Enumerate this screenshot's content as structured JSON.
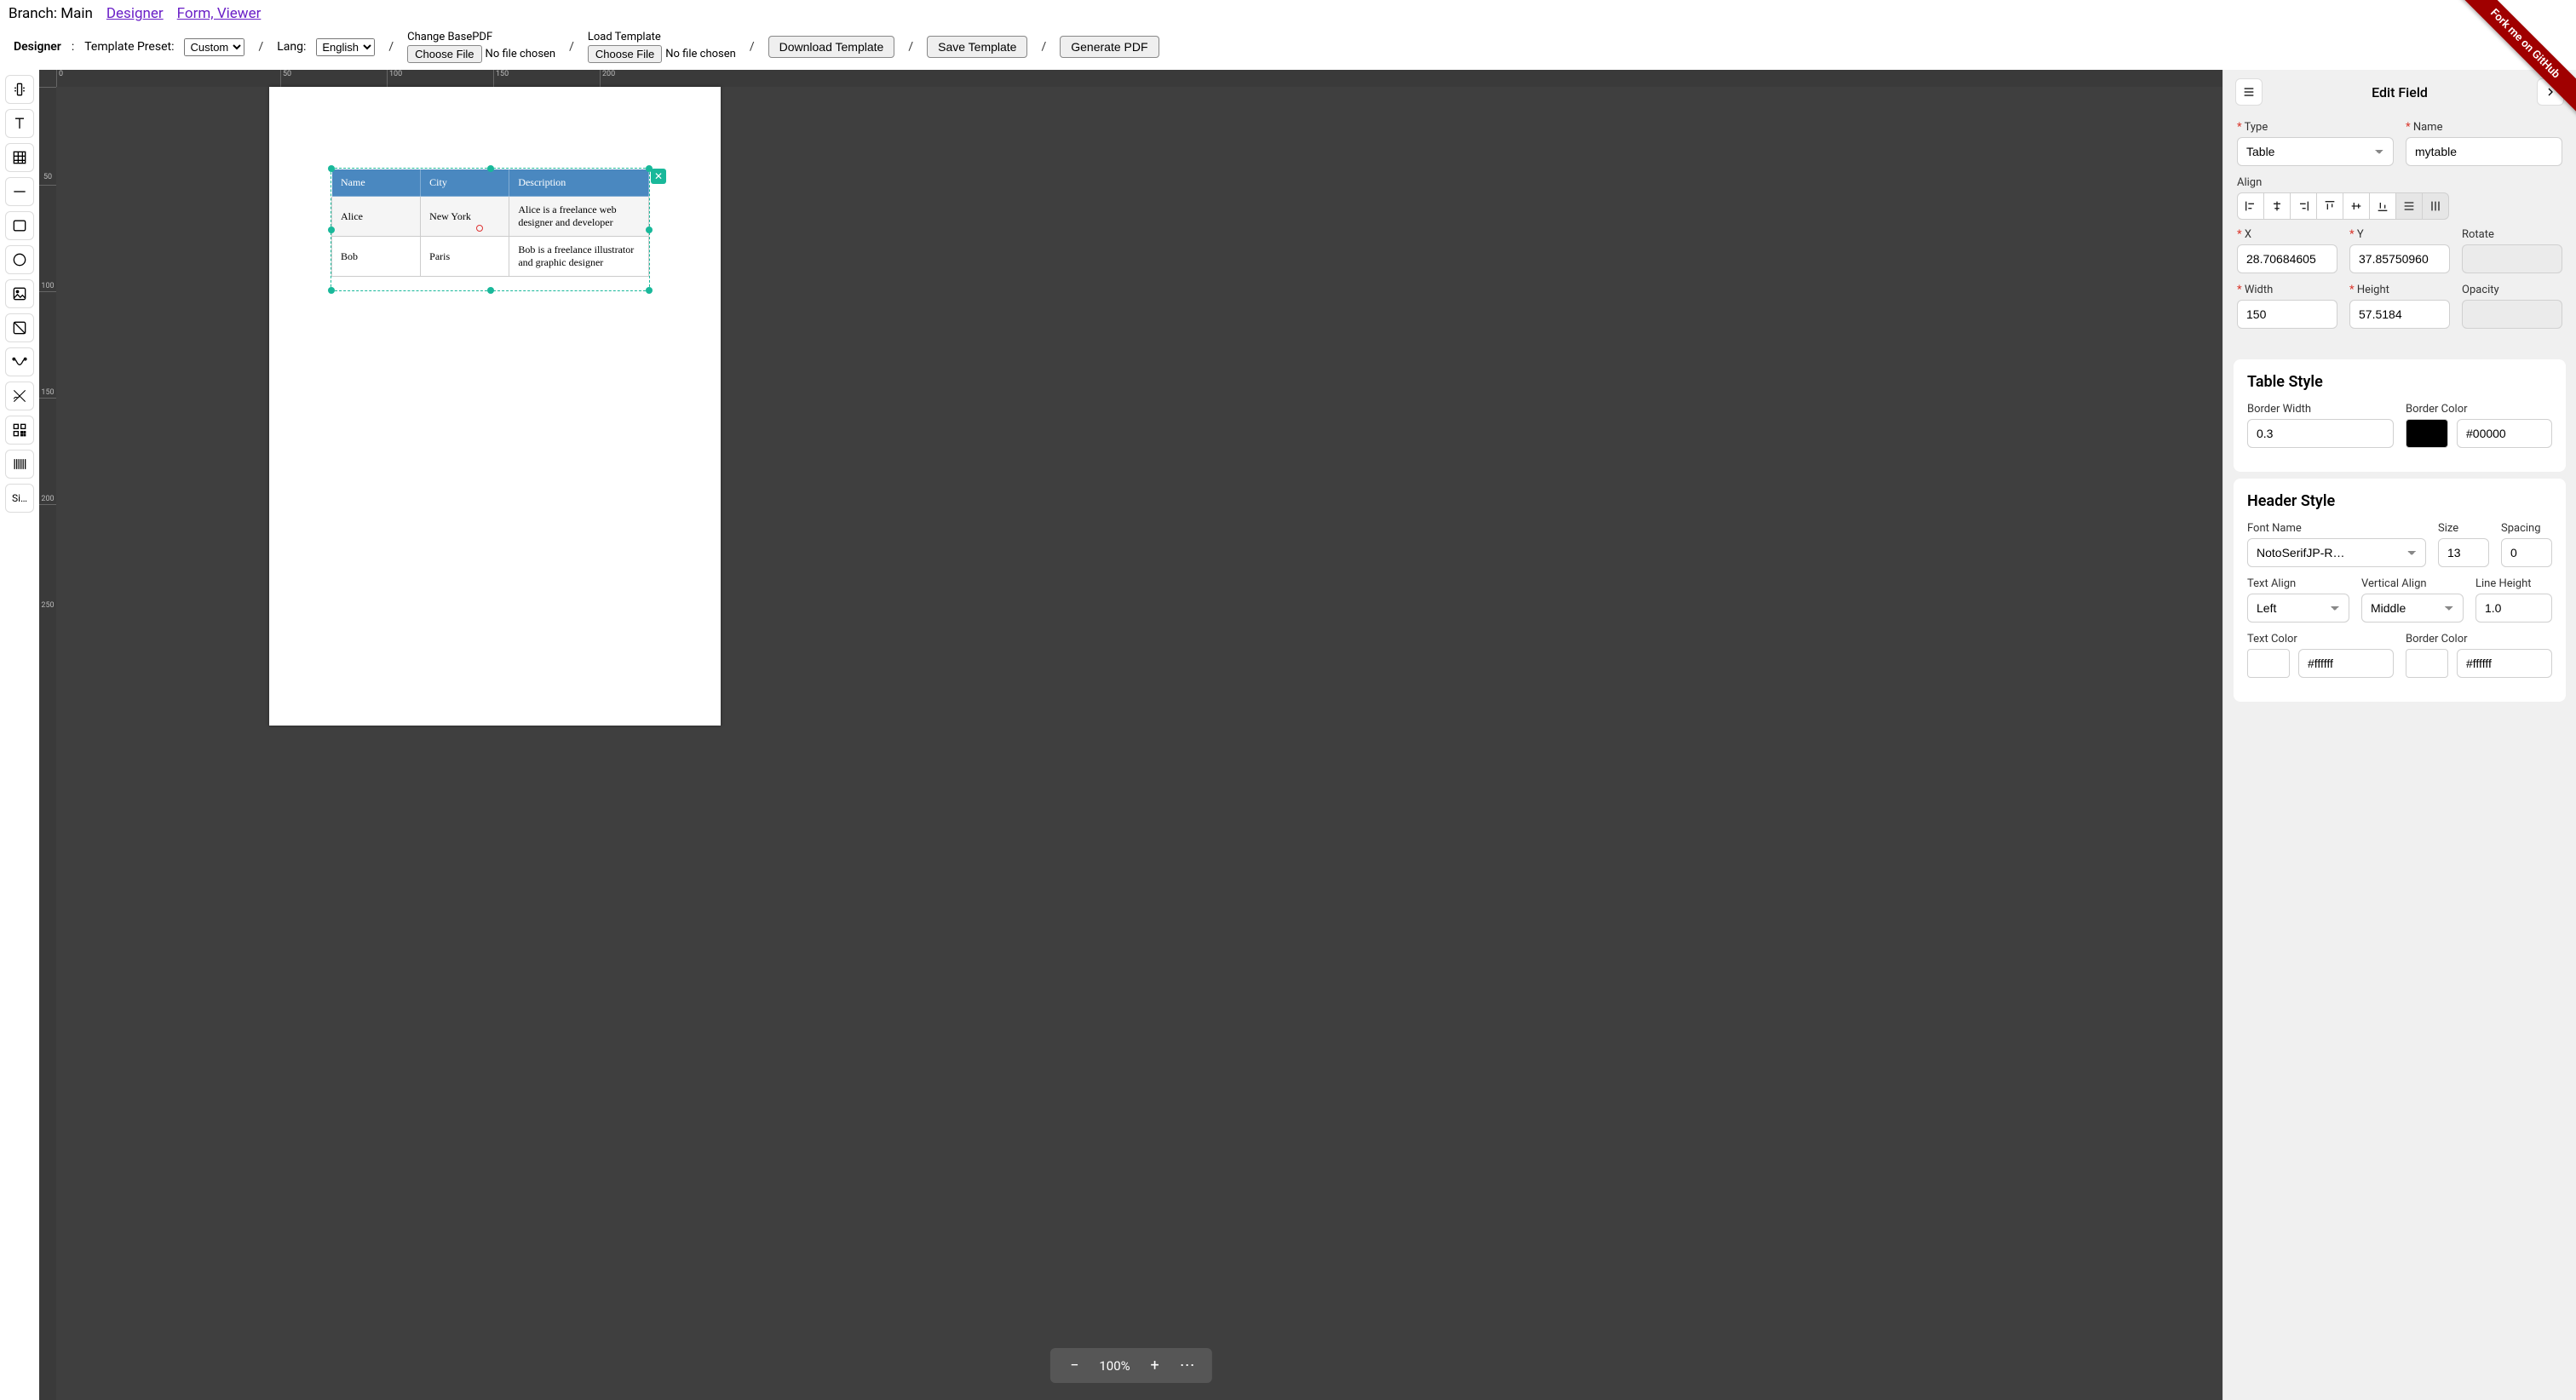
{
  "topnav": {
    "branch_label": "Branch: Main",
    "designer_link": "Designer",
    "form_viewer_link": "Form, Viewer"
  },
  "toolbar": {
    "designer_label": "Designer",
    "colon": ":",
    "template_preset_label": "Template Preset:",
    "template_preset_value": "Custom",
    "lang_label": "Lang:",
    "lang_value": "English",
    "change_basepdf_label": "Change BasePDF",
    "load_template_label": "Load Template",
    "choose_file_label": "Choose File",
    "no_file_chosen": "No file chosen",
    "download_template": "Download Template",
    "save_template": "Save Template",
    "generate_pdf": "Generate PDF",
    "sep": "/"
  },
  "ribbon": {
    "text": "Fork me on GitHub"
  },
  "zoom": {
    "level": "100%"
  },
  "table_element": {
    "headers": [
      "Name",
      "City",
      "Description"
    ],
    "rows": [
      [
        "Alice",
        "New York",
        "Alice is a freelance web designer and developer"
      ],
      [
        "Bob",
        "Paris",
        "Bob is a freelance illustrator and graphic designer"
      ]
    ]
  },
  "rightpanel": {
    "title": "Edit Field",
    "type_label": "Type",
    "type_value": "Table",
    "name_label": "Name",
    "name_value": "mytable",
    "align_label": "Align",
    "x_label": "X",
    "x_value": "28.70684605",
    "y_label": "Y",
    "y_value": "37.85750960",
    "rotate_label": "Rotate",
    "rotate_value": "",
    "width_label": "Width",
    "width_value": "150",
    "height_label": "Height",
    "height_value": "57.5184",
    "opacity_label": "Opacity",
    "opacity_value": "",
    "table_style_title": "Table Style",
    "border_width_label": "Border Width",
    "border_width_value": "0.3",
    "border_color_label": "Border Color",
    "border_color_value": "#00000",
    "border_color_chip": "#000000",
    "header_style_title": "Header Style",
    "font_name_label": "Font Name",
    "font_name_value": "NotoSerifJP-R…",
    "size_label": "Size",
    "size_value": "13",
    "spacing_label": "Spacing",
    "spacing_value": "0",
    "text_align_label": "Text Align",
    "text_align_value": "Left",
    "vertical_align_label": "Vertical Align",
    "vertical_align_value": "Middle",
    "line_height_label": "Line Height",
    "line_height_value": "1.0",
    "text_color_label": "Text Color",
    "hs_border_color_label": "Border Color",
    "text_color_value": "#ffffff",
    "hs_border_color_value": "#ffffff"
  },
  "ruler": {
    "h_ticks": [
      "0",
      "50",
      "100",
      "150",
      "200"
    ],
    "v_ticks": [
      "50",
      "100",
      "150",
      "200",
      "250"
    ]
  }
}
